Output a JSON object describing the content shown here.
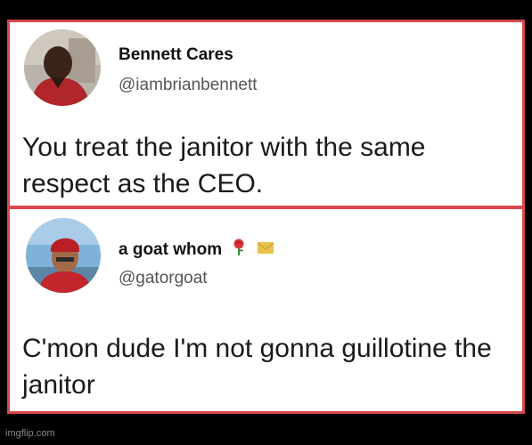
{
  "tweets": [
    {
      "display_name": "Bennett Cares",
      "handle": "@iambrianbennett",
      "text": "You treat the janitor with the same respect as the CEO."
    },
    {
      "display_name": "a goat whom",
      "handle": "@gatorgoat",
      "name_emojis": [
        "rose-icon",
        "envelope-icon"
      ],
      "text": "C'mon dude I'm not gonna guillotine the janitor"
    }
  ],
  "watermark": "imgflip.com",
  "colors": {
    "border": "#d9484a",
    "background": "#000000",
    "card": "#ffffff"
  }
}
